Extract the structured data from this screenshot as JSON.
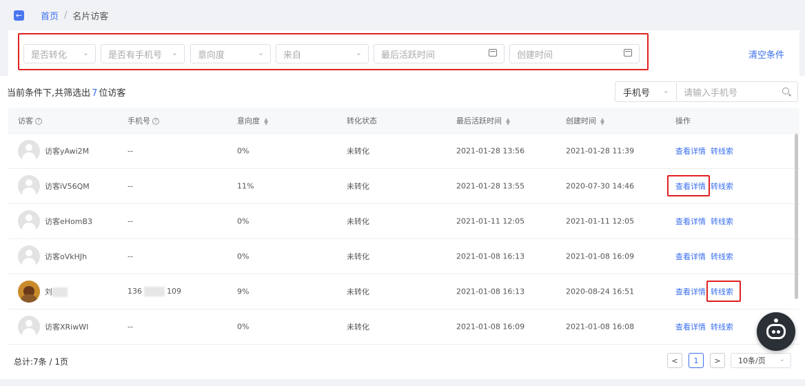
{
  "breadcrumb": {
    "home": "首页",
    "separator": "/",
    "current": "名片访客"
  },
  "filters": {
    "converted": "是否转化",
    "has_phone": "是否有手机号",
    "intent": "意向度",
    "source": "来自",
    "last_active": "最后活跃时间",
    "created": "创建时间",
    "clear": "清空条件"
  },
  "summary": {
    "prefix": "当前条件下,共筛选出",
    "count": "7",
    "suffix": "位访客"
  },
  "search": {
    "type": "手机号",
    "placeholder": "请输入手机号"
  },
  "table": {
    "headers": {
      "visitor": "访客",
      "phone": "手机号",
      "intent": "意向度",
      "status": "转化状态",
      "last_active": "最后活跃时间",
      "created": "创建时间",
      "actions": "操作"
    },
    "action_detail": "查看详情",
    "action_convert": "转线索",
    "rows": [
      {
        "name": "访客yAwi2M",
        "phone": "--",
        "intent": "0%",
        "status": "未转化",
        "last_active": "2021-01-28 13:56",
        "created": "2021-01-28 11:39"
      },
      {
        "name": "访客iV56QM",
        "phone": "--",
        "intent": "11%",
        "status": "未转化",
        "last_active": "2021-01-28 13:55",
        "created": "2020-07-30 14:46"
      },
      {
        "name": "访客eHomB3",
        "phone": "--",
        "intent": "0%",
        "status": "未转化",
        "last_active": "2021-01-11 12:05",
        "created": "2021-01-11 12:05"
      },
      {
        "name": "访客oVkHJh",
        "phone": "--",
        "intent": "0%",
        "status": "未转化",
        "last_active": "2021-01-08 16:13",
        "created": "2021-01-08 16:09"
      },
      {
        "name": "刘",
        "phone_prefix": "136",
        "phone_suffix": "109",
        "intent": "9%",
        "status": "未转化",
        "last_active": "2021-01-08 16:13",
        "created": "2020-08-24 16:51"
      },
      {
        "name": "访客XRiwWI",
        "phone": "--",
        "intent": "0%",
        "status": "未转化",
        "last_active": "2021-01-08 16:09",
        "created": "2021-01-08 16:08"
      }
    ]
  },
  "pagination": {
    "total": "总计:7条 / 1页",
    "prev": "<",
    "page": "1",
    "next": ">",
    "page_size": "10条/页"
  },
  "icons": {
    "back": "back-arrow-icon",
    "assistant": "robot-icon"
  },
  "colors": {
    "accent": "#3a6ff0",
    "highlight": "#e02020"
  }
}
